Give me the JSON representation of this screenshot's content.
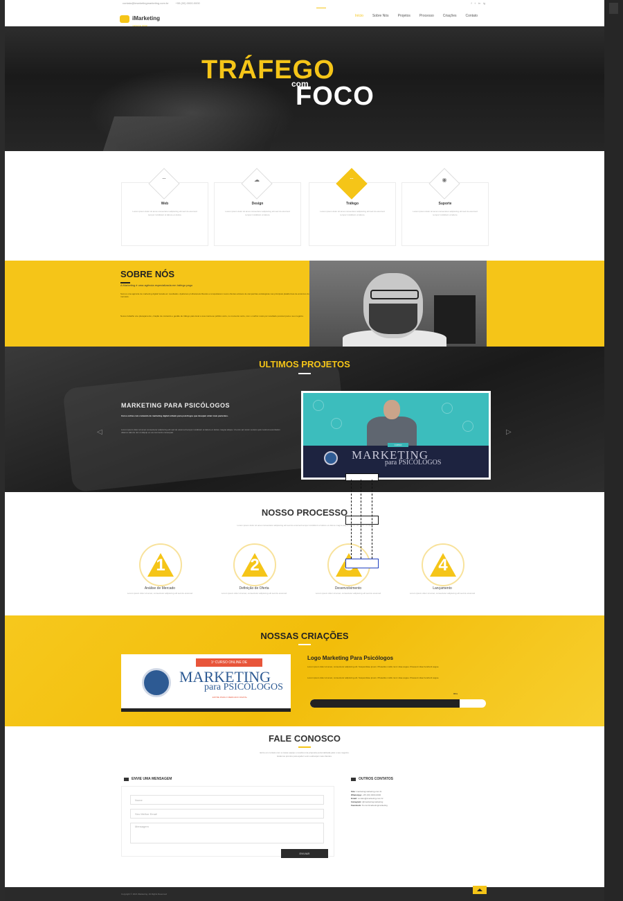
{
  "header": {
    "email": "contato@imarketingmarketing.com.br",
    "phone": "+55 (00) 0000-0000",
    "logo_title": "iMarketing",
    "logo_sub": "marketing digital",
    "nav": [
      "Início",
      "Sobre Nós",
      "Projetos",
      "Processo",
      "Criações",
      "Contato"
    ],
    "social": [
      "f",
      "t",
      "in",
      "ig"
    ]
  },
  "hero": {
    "line1": "TRÁFEGO",
    "line2": "com",
    "line3": "FOCO"
  },
  "services": [
    {
      "icon": "wifi-icon",
      "glyph": "⌔",
      "title": "Web",
      "desc": "Lorem ipsum dolor sit amet consectetur adipiscing elit sed do eiusmod tempor incididunt ut labore et dolore"
    },
    {
      "icon": "cloud-icon",
      "glyph": "☁",
      "title": "Design",
      "desc": "Lorem ipsum dolor sit amet consectetur adipiscing elit sed do eiusmod tempor incididunt ut labore"
    },
    {
      "icon": "signal-icon",
      "glyph": "⌔",
      "title": "Tráfego",
      "desc": "Lorem ipsum dolor sit amet consectetur adipiscing elit sed do eiusmod tempor incididunt ut labore"
    },
    {
      "icon": "chat-icon",
      "glyph": "◉",
      "title": "Suporte",
      "desc": "Lorem ipsum dolor sit amet consectetur adipiscing elit sed do eiusmod tempor incididunt ut labore"
    }
  ],
  "about": {
    "title": "SOBRE NÓS",
    "subtitle": "A Marketing é uma agência especializada em tráfego pago",
    "paragraphs": [
      "Somos uma agência de marketing digital focada em resultados. Ajudamos profissionais liberais a conquistarem novos clientes através de campanhas estratégicas nas principais plataformas de anúncios do mercado.",
      "Nosso trabalho une planejamento, criação de conteúdo e gestão de tráfego para levar a sua marca ao público certo, no momento certo, com o melhor custo por resultado possível para o seu negócio."
    ]
  },
  "projects": {
    "title": "ULTIMOS PROJETOS",
    "project_title": "MARKETING PARA PSICÓLOGOS",
    "lead": "Curso online com conteúdo de marketing digital voltado para psicólogos que desejam atrair mais pacientes.",
    "body": "Lorem ipsum dolor sit amet consectetur adipiscing elit sed do eiusmod tempor incididunt ut labore et dolore magna aliqua. Ut enim ad minim veniam quis nostrud exercitation ullamco laboris nisi ut aliquip ex ea commodo consequat.",
    "thumb_tag": "CURSO",
    "thumb_title1": "MARKETING",
    "thumb_title2": "para PSICÓLOGOS"
  },
  "process": {
    "title": "NOSSO PROCESSO",
    "subtitle": "Lorem ipsum dolor sit amet consectetur adipiscing elit sed do eiusmod tempor incididunt ut labore et dolore magna aliqua ut enim ad minim veniam",
    "steps": [
      {
        "num": "1",
        "label": "Análise de Mercado",
        "desc": "Lorem ipsum dolor sit amet, consectetur adipiscing elit sed do eiusmod"
      },
      {
        "num": "2",
        "label": "Definição de Oferta",
        "desc": "Lorem ipsum dolor sit amet, consectetur adipiscing elit sed do eiusmod"
      },
      {
        "num": "3",
        "label": "Desenvolvimento",
        "desc": "Lorem ipsum dolor sit amet, consectetur adipiscing elit sed do eiusmod"
      },
      {
        "num": "4",
        "label": "Lançamento",
        "desc": "Lorem ipsum dolor sit amet, consectetur adipiscing elit sed do eiusmod"
      }
    ]
  },
  "creations": {
    "title": "NOSSAS CRIAÇÕES",
    "banner": "1º CURSO ONLINE DE",
    "logo_title1": "MARKETING",
    "logo_title2": "para PSICÓLOGOS",
    "logo_tagline": "ENTRE PARA O MERCADO DIGITAL",
    "item_title": "Logo Marketing Para Psicólogos",
    "paragraphs": [
      "Lorem ipsum dolor sit amet, consectetur adipiscing elit. Suspendisse ipsum. Phasellus mollis nunc vitae augue. Praesent vitae hendrerit augue.",
      "Lorem ipsum dolor sit amet, consectetur adipiscing elit. Suspendisse ipsum. Phasellus mollis nunc vitae augue. Praesent vitae hendrerit augue."
    ],
    "progress_label": "85%",
    "progress": 0.85
  },
  "contact": {
    "title": "FALE CONOSCO",
    "subtitle_lines": [
      "Entre em contato com a nossa equipe e receba uma proposta personalizada para o seu negócio.",
      "Estamos prontos para ajudar você a alcançar mais clientes."
    ],
    "form_heading": "ENVIE UMA MENSAGEM",
    "name_placeholder": "Nome",
    "email_placeholder": "Seu Melhor Email",
    "message_placeholder": "Mensagem",
    "send_label": "ENVIAR",
    "info_heading": "OUTROS CONTATOS",
    "info": [
      {
        "k": "Site:",
        "v": "imarketingmarketing.com.br"
      },
      {
        "k": "WhatsApp:",
        "v": "+55 (00) 0000-0000"
      },
      {
        "k": "Email:",
        "v": "contato@imarketing.com.br"
      },
      {
        "k": "Instagram:",
        "v": "@imarketingmarketing"
      },
      {
        "k": "Facebook:",
        "v": "fb.com/imarketingmarketing"
      }
    ]
  },
  "footer": {
    "copyright": "Copyright © 2021 iMarketing. All Rights Reserved"
  }
}
